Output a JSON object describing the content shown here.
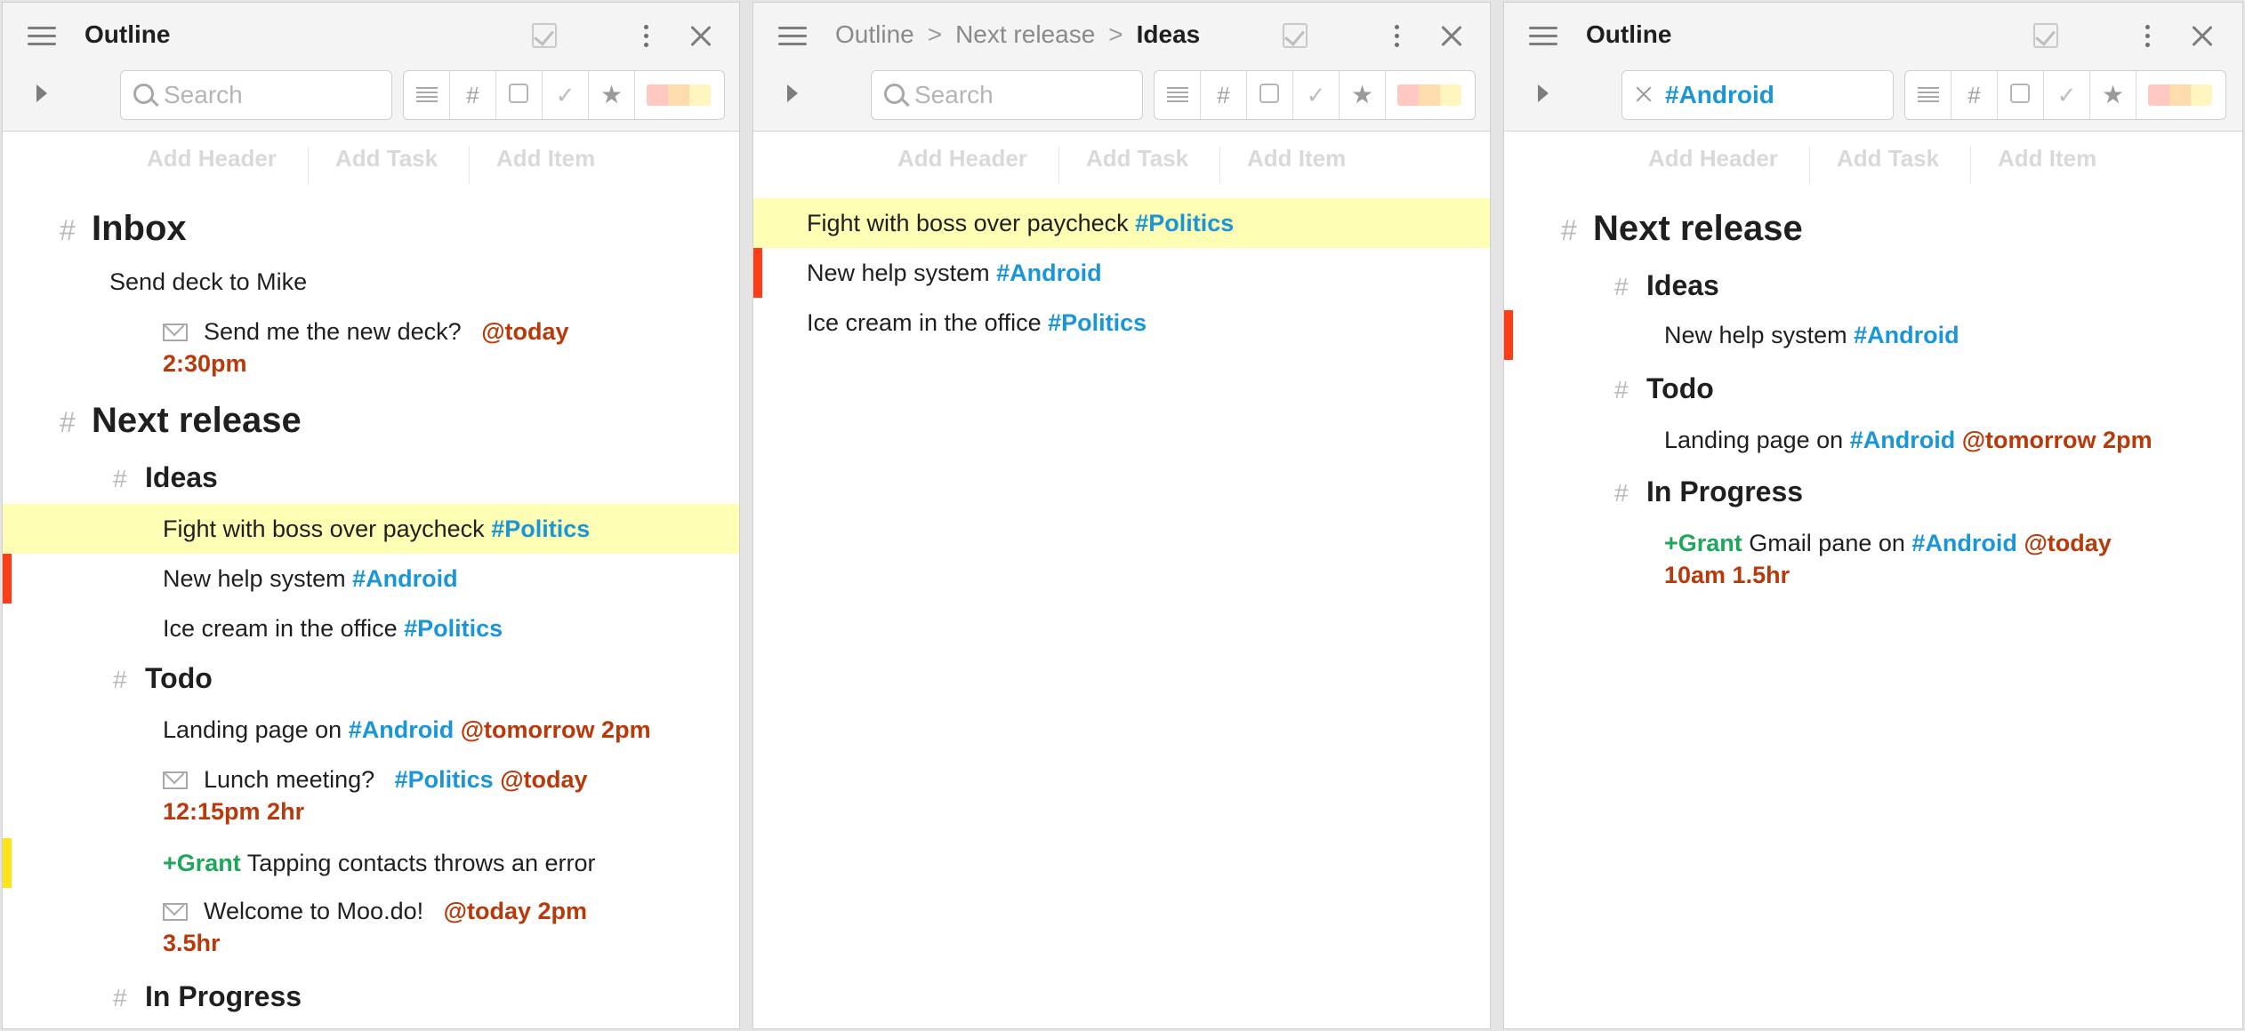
{
  "colors": {
    "tag": "#1a96d8",
    "date": "#b83a0a",
    "person": "#1ea65a",
    "highlight": "#fefeb5",
    "priority_red": "#fd3d16",
    "priority_yellow": "#fde515"
  },
  "filters": {
    "colors_label": "color filter"
  },
  "add_bar": {
    "header": "Add Header",
    "task": "Add Task",
    "item": "Add Item"
  },
  "panel1": {
    "title": "Outline",
    "search_placeholder": "Search",
    "search_value": "",
    "inbox": {
      "title": "Inbox",
      "items": [
        {
          "text": "Send deck to Mike"
        },
        {
          "text": "Send me the new deck?",
          "date1": "@today",
          "date2": "2:30pm"
        }
      ]
    },
    "next_release": {
      "title": "Next release",
      "ideas": {
        "title": "Ideas",
        "items": [
          {
            "text": "Fight with boss over paycheck",
            "tag": "#Politics"
          },
          {
            "text": "New help system",
            "tag": "#Android"
          },
          {
            "text": "Ice cream in the office",
            "tag": "#Politics"
          }
        ]
      },
      "todo": {
        "title": "Todo",
        "items": [
          {
            "text": "Landing page on",
            "tag": "#Android",
            "date": "@tomorrow 2pm"
          },
          {
            "text": "Lunch meeting?",
            "tag": "#Politics",
            "date1": "@today",
            "date2": "12:15pm 2hr"
          },
          {
            "person": "+Grant",
            "text": "Tapping contacts throws an error"
          },
          {
            "text": "Welcome to Moo.do!",
            "date1": "@today 2pm",
            "date2": "3.5hr"
          }
        ]
      },
      "in_progress": {
        "title": "In Progress"
      }
    }
  },
  "panel2": {
    "breadcrumbs": [
      "Outline",
      "Next release",
      "Ideas"
    ],
    "breadcrumb_sep": ">",
    "search_placeholder": "Search",
    "items": [
      {
        "text": "Fight with boss over paycheck",
        "tag": "#Politics"
      },
      {
        "text": "New help system",
        "tag": "#Android"
      },
      {
        "text": "Ice cream in the office",
        "tag": "#Politics"
      }
    ]
  },
  "panel3": {
    "title": "Outline",
    "search_value": "#Android",
    "next_release": {
      "title": "Next release",
      "ideas": {
        "title": "Ideas",
        "items": [
          {
            "text": "New help system",
            "tag": "#Android"
          }
        ]
      },
      "todo": {
        "title": "Todo",
        "items": [
          {
            "text": "Landing page on",
            "tag": "#Android",
            "date": "@tomorrow 2pm"
          }
        ]
      },
      "in_progress": {
        "title": "In Progress",
        "items": [
          {
            "person": "+Grant",
            "text": "Gmail pane on",
            "tag": "#Android",
            "date1": "@today",
            "date2": "10am 1.5hr"
          }
        ]
      }
    }
  }
}
